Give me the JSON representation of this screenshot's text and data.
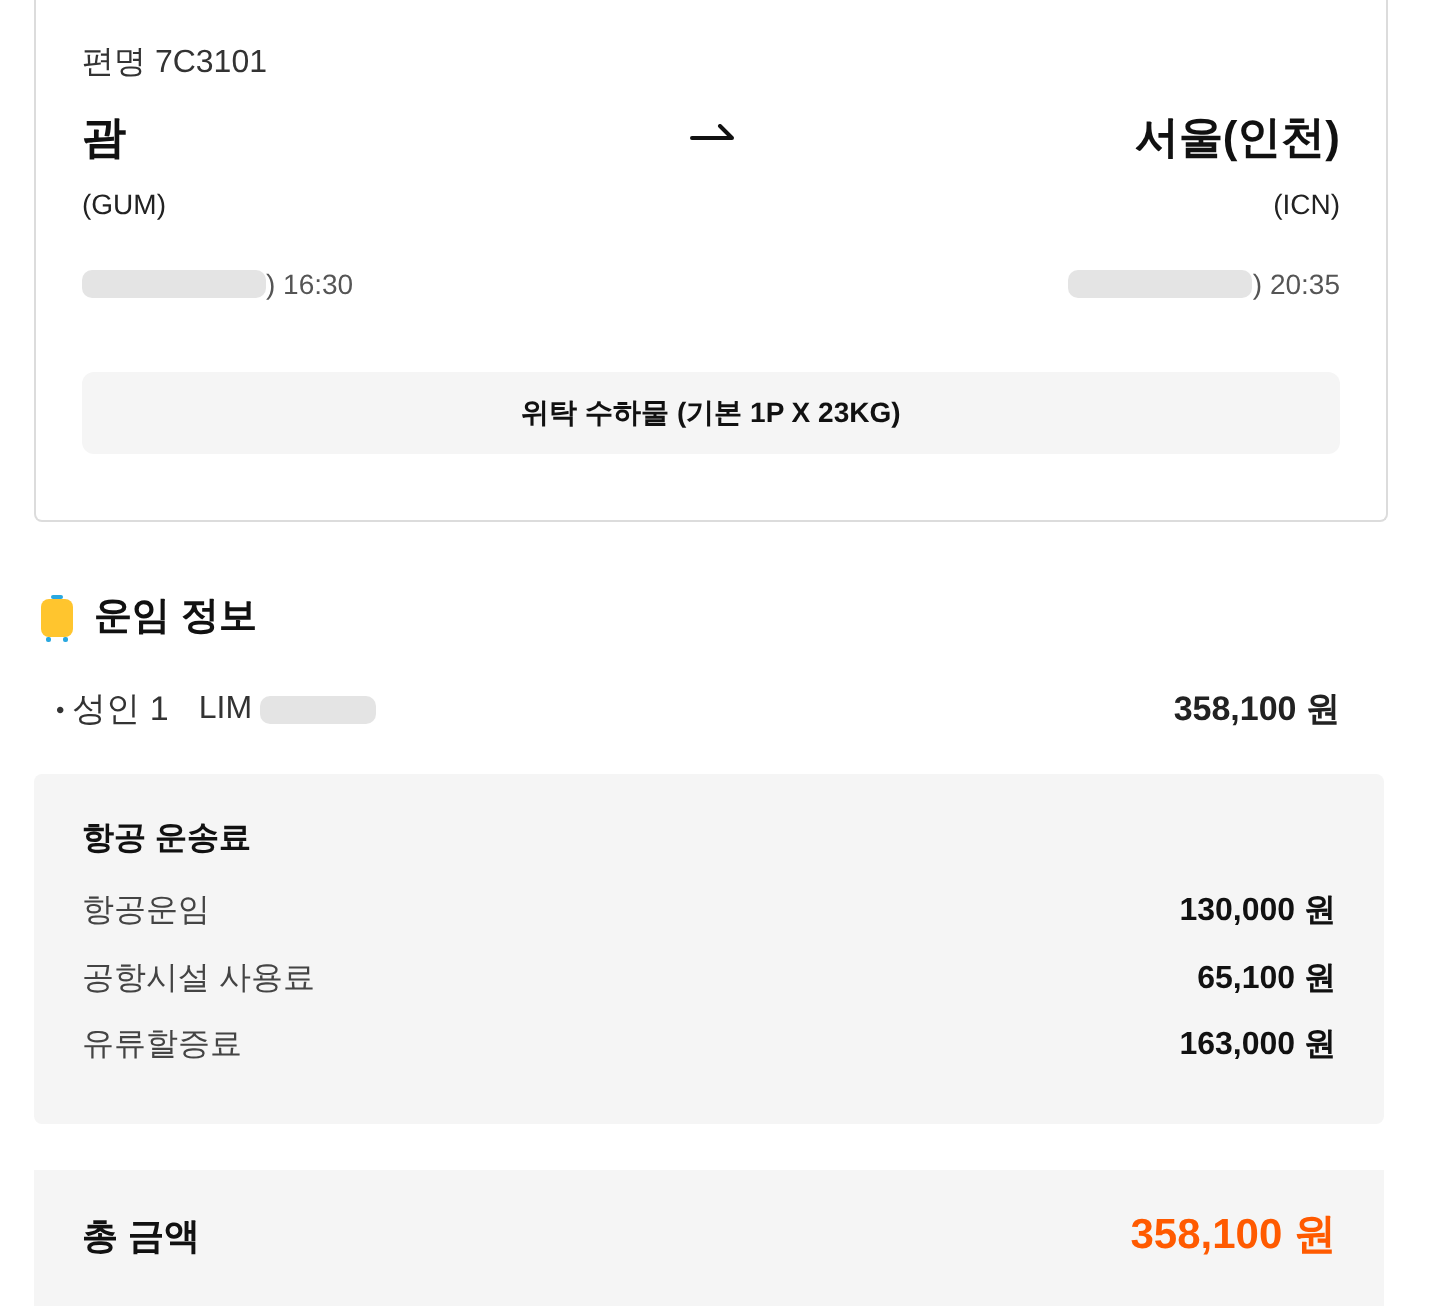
{
  "flight_card": {
    "flight_label": "편명 7C3101",
    "origin": {
      "city": "괌",
      "code": "(GUM)",
      "time": ") 16:30"
    },
    "destination": {
      "city": "서울(인천)",
      "code": "(ICN)",
      "time": ") 20:35"
    },
    "baggage": "위탁 수하물 (기본 1P X 23KG)"
  },
  "fare_info": {
    "title": "운임 정보",
    "passengers": [
      {
        "bullet": "•",
        "type": "성인 1",
        "name": "LIM",
        "amount": "358,100 원"
      }
    ]
  },
  "air_fare": {
    "title": "항공 운송료",
    "rows": [
      {
        "label": "항공운임",
        "amount": "130,000 원"
      },
      {
        "label": "공항시설 사용료",
        "amount": "65,100 원"
      },
      {
        "label": "유류할증료",
        "amount": "163,000 원"
      }
    ]
  },
  "total": {
    "label": "총 금액",
    "amount": "358,100 원"
  }
}
